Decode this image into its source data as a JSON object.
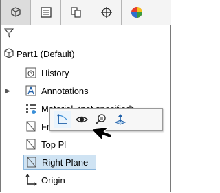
{
  "tabs": [
    {
      "icon": "feature-manager-icon",
      "active": true
    },
    {
      "icon": "property-manager-icon",
      "active": false
    },
    {
      "icon": "configuration-manager-icon",
      "active": false
    },
    {
      "icon": "dimxpert-manager-icon",
      "active": false
    },
    {
      "icon": "display-manager-icon",
      "active": false
    }
  ],
  "filter_icon": "filter-icon",
  "tree": {
    "root": "Part1  (Default)",
    "history": "History",
    "annotations": "Annotations",
    "material": "Material <not specified>",
    "front_plane": "Front P",
    "top_plane": "Top Pl",
    "right_plane": "Right Plane",
    "origin": "Origin"
  },
  "context_toolbar": {
    "items": [
      "sketch-icon",
      "show-hide-icon",
      "zoom-to-selection-icon",
      "normal-to-icon"
    ]
  },
  "colors": {
    "selection": "#cfe3f3",
    "accent": "#3a8fd8"
  }
}
